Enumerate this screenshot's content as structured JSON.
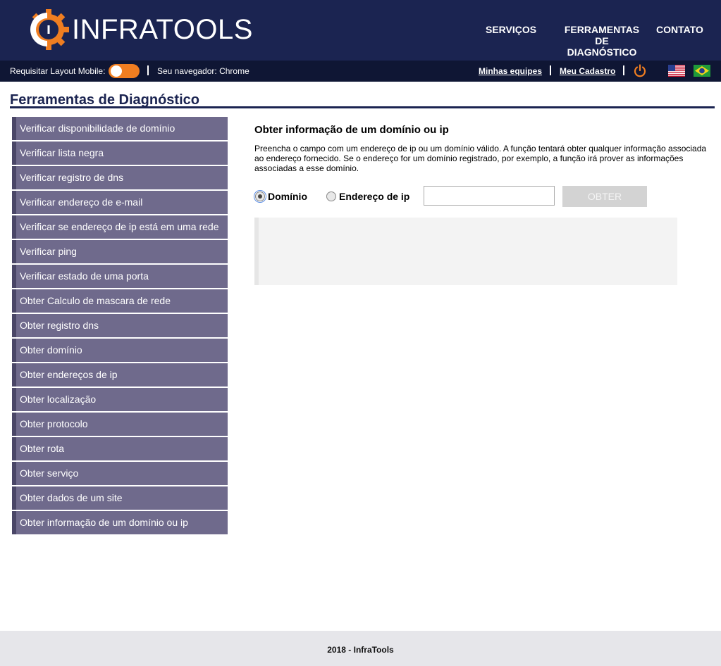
{
  "brand": {
    "name": "INFRATOOLS",
    "accent": "#f07e21",
    "navy": "#1b2451"
  },
  "nav": {
    "servicos": "SERVIÇOS",
    "ferramentas_line1": "FERRAMENTAS",
    "ferramentas_line2": "DE",
    "ferramentas_line3": "DIAGNÓSTICO",
    "contato": "CONTATO"
  },
  "subbar": {
    "mobile_label": "Requisitar Layout Mobile:",
    "mobile_toggle": "on",
    "browser_label": "Seu navegador: Chrome",
    "minhas_equipes": "Minhas equipes",
    "meu_cadastro": "Meu Cadastro",
    "power_icon": "power-icon",
    "flags": [
      "us-flag-icon",
      "br-flag-icon"
    ]
  },
  "page_title": "Ferramentas de Diagnóstico",
  "sidebar": {
    "items": [
      "Verificar disponibilidade de domínio",
      "Verificar lista negra",
      "Verificar registro de dns",
      "Verificar endereço de e-mail",
      "Verificar se endereço de ip está em uma rede",
      "Verificar ping",
      "Verificar estado de uma porta",
      "Obter Calculo de mascara de rede",
      "Obter registro dns",
      "Obter domínio",
      "Obter endereços de ip",
      "Obter localização",
      "Obter protocolo",
      "Obter rota",
      "Obter serviço",
      "Obter dados de um site",
      "Obter informação de um domínio ou ip"
    ]
  },
  "main": {
    "title": "Obter informação de um domínio ou ip",
    "description": "Preencha o campo com um endereço de ip ou um domínio válido. A função tentará obter qualquer informação associada ao endereço fornecido. Se o endereço for um domínio registrado, por exemplo, a função irá prover as informações associadas a esse domínio.",
    "radio_dominio": "Domínio",
    "radio_ip": "Endereço de ip",
    "selected": "Domínio",
    "input_value": "",
    "button": "OBTER"
  },
  "footer": {
    "text": "2018 - InfraTools"
  }
}
